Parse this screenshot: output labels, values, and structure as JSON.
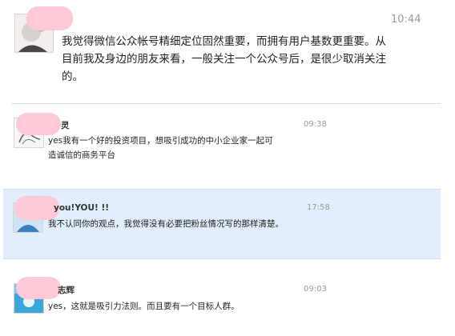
{
  "posts": [
    {
      "name": "",
      "time": "10:44",
      "text": "我觉得微信公众帐号精细定位固然重要，而拥有用户基数更重要。从目前我及身边的朋友来看，一般关注一个公众号后，是很少取消关注的。",
      "avatar_icon": "user-avatar-icon"
    },
    {
      "name": "灵",
      "time": "09:38",
      "text": "yes我有一个好的投资项目，想吸引成功的中小企业家一起可造诚信的商务平台",
      "avatar_icon": "user-avatar-icon"
    },
    {
      "name": "you!YOU! !!",
      "time": "17:58",
      "text": "我不认同你的观点，我觉得没有必要把粉丝情况写的那样清楚。",
      "avatar_icon": "user-avatar-icon"
    },
    {
      "name": "志辉",
      "time": "09:03",
      "text": "yes，这就是吸引力法则。而且要有一个目标人群。",
      "avatar_icon": "user-avatar-icon"
    }
  ],
  "colors": {
    "redaction": "#ffc9d7",
    "highlight": "#e2eefb",
    "timestamp": "#9a9a9a"
  }
}
